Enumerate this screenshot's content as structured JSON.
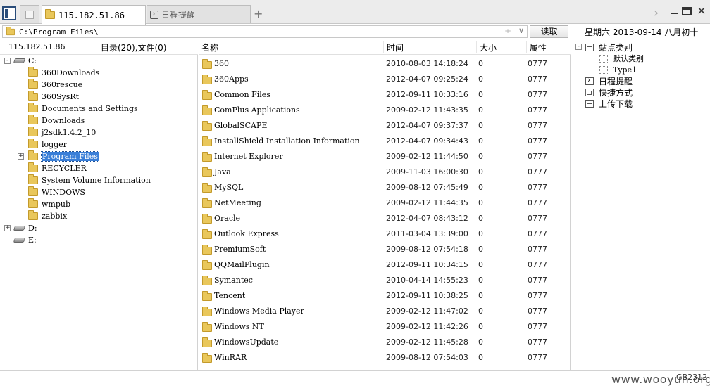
{
  "tabs": [
    {
      "label": ""
    },
    {
      "label": "115.182.51.86",
      "active": true
    },
    {
      "label": "日程提醒"
    }
  ],
  "tab_add_symbol": "+",
  "tab_scroll_symbol": "›",
  "window": {
    "close_symbol": "✕"
  },
  "address": {
    "path": "C:\\Program Files\\",
    "pin_symbol": "±",
    "dropdown_symbol": "∨",
    "read_button": "读取",
    "date": "星期六 2013-09-14 八月初十"
  },
  "left": {
    "host": "115.182.51.86",
    "summary": "目录(20),文件(0)",
    "tree": [
      {
        "expander": "-",
        "type": "drive",
        "label": "C:"
      },
      {
        "type": "folder",
        "label": "360Downloads"
      },
      {
        "type": "folder",
        "label": "360rescue"
      },
      {
        "type": "folder",
        "label": "360SysRt"
      },
      {
        "type": "folder",
        "label": "Documents and Settings"
      },
      {
        "type": "folder",
        "label": "Downloads"
      },
      {
        "type": "folder",
        "label": "j2sdk1.4.2_10"
      },
      {
        "type": "folder",
        "label": "logger"
      },
      {
        "expander": "+",
        "type": "folder",
        "label": "Program Files",
        "selected": true
      },
      {
        "type": "folder",
        "label": "RECYCLER"
      },
      {
        "type": "folder",
        "label": "System Volume Information"
      },
      {
        "type": "folder",
        "label": "WINDOWS"
      },
      {
        "type": "folder",
        "label": "wmpub"
      },
      {
        "type": "folder",
        "label": "zabbix"
      },
      {
        "expander": "+",
        "type": "drive",
        "label": "D:"
      },
      {
        "type": "drive",
        "label": "E:"
      }
    ]
  },
  "list": {
    "columns": {
      "name": "名称",
      "time": "时间",
      "size": "大小",
      "attr": "属性"
    },
    "rows": [
      {
        "name": "360",
        "time": "2010-08-03 14:18:24",
        "size": "0",
        "attr": "0777"
      },
      {
        "name": "360Apps",
        "time": "2012-04-07 09:25:24",
        "size": "0",
        "attr": "0777"
      },
      {
        "name": "Common Files",
        "time": "2012-09-11 10:33:16",
        "size": "0",
        "attr": "0777"
      },
      {
        "name": "ComPlus Applications",
        "time": "2009-02-12 11:43:35",
        "size": "0",
        "attr": "0777"
      },
      {
        "name": "GlobalSCAPE",
        "time": "2012-04-07 09:37:37",
        "size": "0",
        "attr": "0777"
      },
      {
        "name": "InstallShield Installation Information",
        "time": "2012-04-07 09:34:43",
        "size": "0",
        "attr": "0777"
      },
      {
        "name": "Internet Explorer",
        "time": "2009-02-12 11:44:50",
        "size": "0",
        "attr": "0777"
      },
      {
        "name": "Java",
        "time": "2009-11-03 16:00:30",
        "size": "0",
        "attr": "0777"
      },
      {
        "name": "MySQL",
        "time": "2009-08-12 07:45:49",
        "size": "0",
        "attr": "0777"
      },
      {
        "name": "NetMeeting",
        "time": "2009-02-12 11:44:35",
        "size": "0",
        "attr": "0777"
      },
      {
        "name": "Oracle",
        "time": "2012-04-07 08:43:12",
        "size": "0",
        "attr": "0777"
      },
      {
        "name": "Outlook Express",
        "time": "2011-03-04 13:39:00",
        "size": "0",
        "attr": "0777"
      },
      {
        "name": "PremiumSoft",
        "time": "2009-08-12 07:54:18",
        "size": "0",
        "attr": "0777"
      },
      {
        "name": "QQMailPlugin",
        "time": "2012-09-11 10:34:15",
        "size": "0",
        "attr": "0777"
      },
      {
        "name": "Symantec",
        "time": "2010-04-14 14:55:23",
        "size": "0",
        "attr": "0777"
      },
      {
        "name": "Tencent",
        "time": "2012-09-11 10:38:25",
        "size": "0",
        "attr": "0777"
      },
      {
        "name": "Windows Media Player",
        "time": "2009-02-12 11:47:02",
        "size": "0",
        "attr": "0777"
      },
      {
        "name": "Windows NT",
        "time": "2009-02-12 11:42:26",
        "size": "0",
        "attr": "0777"
      },
      {
        "name": "WindowsUpdate",
        "time": "2009-02-12 11:45:28",
        "size": "0",
        "attr": "0777"
      },
      {
        "name": "WinRAR",
        "time": "2009-08-12 07:54:03",
        "size": "0",
        "attr": "0777"
      }
    ]
  },
  "right": {
    "items": [
      {
        "label": "站点类别",
        "icon": "category-icon",
        "expander": "-"
      },
      {
        "label": "默认类别",
        "icon": "default-category-icon",
        "sub": true
      },
      {
        "label": "Type1",
        "icon": "type-icon",
        "sub": true
      },
      {
        "label": "日程提醒",
        "icon": "schedule-icon"
      },
      {
        "label": "快捷方式",
        "icon": "shortcut-icon"
      },
      {
        "label": "上传下载",
        "icon": "upload-download-icon"
      }
    ]
  },
  "status": {
    "code": "GB2312"
  },
  "watermark": "www.wooyun.org"
}
